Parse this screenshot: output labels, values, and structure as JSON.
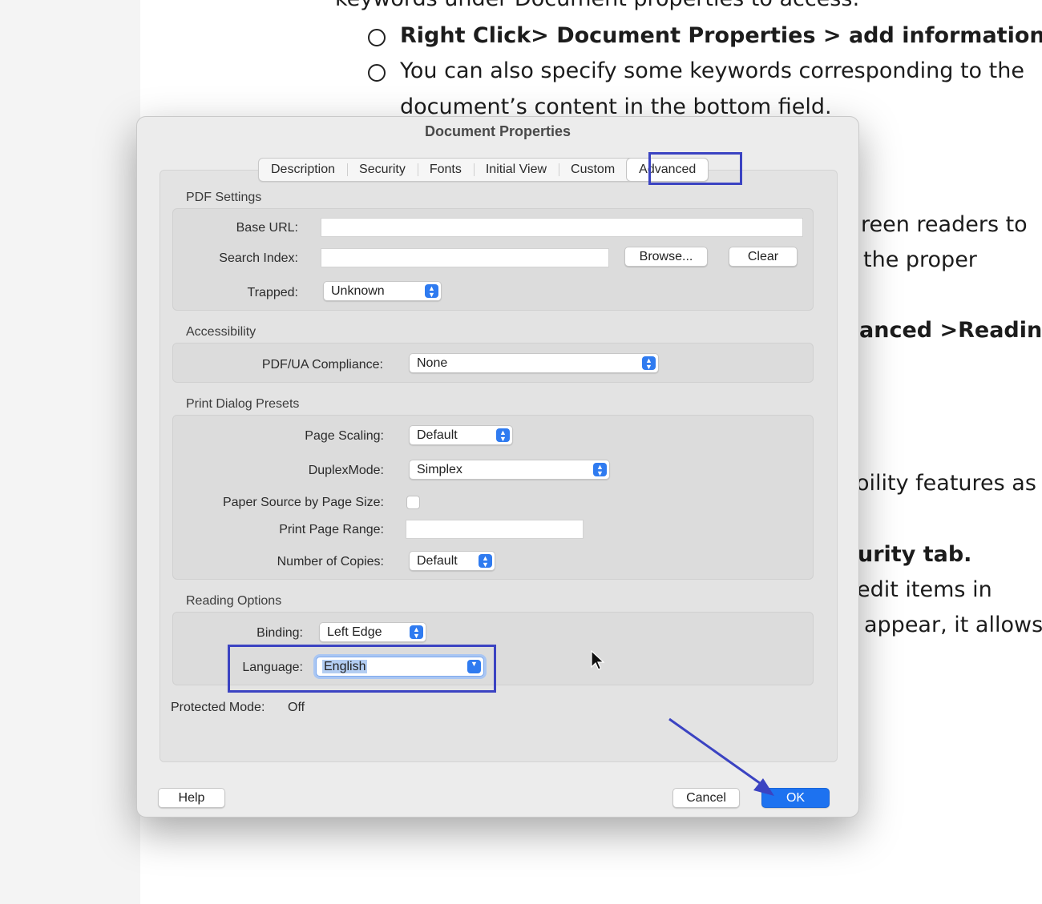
{
  "background_doc": {
    "line1": "keywords under Document properties to access:",
    "bullet1": "Right Click> Document Properties > add information.",
    "bullet2_line1": "You can also specify some keywords corresponding to the",
    "bullet2_line2": "document’s content in the bottom field.",
    "frag_screen_readers": "reen readers to",
    "frag_proper": "the proper",
    "frag_reading": "anced >Reading",
    "frag_features": "oility features as",
    "frag_security": "urity tab.",
    "frag_edit": "edit items in",
    "frag_appear": "appear, it allows"
  },
  "dialog": {
    "title": "Document Properties",
    "tabs": [
      {
        "label": "Description"
      },
      {
        "label": "Security"
      },
      {
        "label": "Fonts"
      },
      {
        "label": "Initial View"
      },
      {
        "label": "Custom"
      },
      {
        "label": "Advanced",
        "active": true
      }
    ],
    "pdf_settings": {
      "section": "PDF Settings",
      "base_url_label": "Base URL:",
      "base_url_value": "",
      "search_index_label": "Search Index:",
      "search_index_value": "",
      "browse_label": "Browse...",
      "clear_label": "Clear",
      "trapped_label": "Trapped:",
      "trapped_value": "Unknown"
    },
    "accessibility": {
      "section": "Accessibility",
      "pdfua_label": "PDF/UA Compliance:",
      "pdfua_value": "None"
    },
    "print_presets": {
      "section": "Print Dialog Presets",
      "page_scaling_label": "Page Scaling:",
      "page_scaling_value": "Default",
      "duplex_label": "DuplexMode:",
      "duplex_value": "Simplex",
      "paper_source_label": "Paper Source by Page Size:",
      "paper_source_checked": false,
      "page_range_label": "Print Page Range:",
      "page_range_value": "",
      "copies_label": "Number of Copies:",
      "copies_value": "Default"
    },
    "reading_options": {
      "section": "Reading Options",
      "binding_label": "Binding:",
      "binding_value": "Left Edge",
      "language_label": "Language:",
      "language_value": "English"
    },
    "protected_mode_label": "Protected Mode:",
    "protected_mode_value": "Off",
    "help_label": "Help",
    "cancel_label": "Cancel",
    "ok_label": "OK"
  },
  "colors": {
    "annotation": "#3b43c2",
    "accent_blue": "#1d72f0"
  }
}
